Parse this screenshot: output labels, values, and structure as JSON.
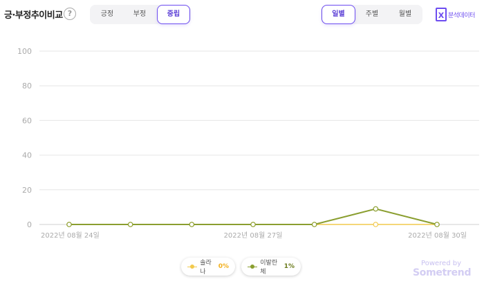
{
  "header": {
    "title": "긍·부정추이비교",
    "help_icon": "?",
    "sentiment_tabs": [
      {
        "label": "긍정",
        "active": false
      },
      {
        "label": "부정",
        "active": false
      },
      {
        "label": "중립",
        "active": true
      }
    ],
    "period_tabs": [
      {
        "label": "일별",
        "active": true
      },
      {
        "label": "주별",
        "active": false
      },
      {
        "label": "월별",
        "active": false
      }
    ],
    "analysis_button": {
      "label": "분석데이터",
      "icon": "excel-icon",
      "icon_glyph": "X"
    }
  },
  "chart_data": {
    "type": "line",
    "x": [
      "2022-08-24",
      "2022-08-25",
      "2022-08-26",
      "2022-08-27",
      "2022-08-28",
      "2022-08-29",
      "2022-08-30"
    ],
    "x_tick_labels": [
      "2022년 08월 24일",
      "",
      "",
      "2022년 08월 27일",
      "",
      "",
      "2022년 08월 30일"
    ],
    "ylim": [
      0,
      100
    ],
    "y_ticks": [
      0,
      20,
      40,
      60,
      80,
      100
    ],
    "grid": true,
    "legend_placement": "bottom",
    "series": [
      {
        "name": "솔라나",
        "values": [
          0,
          0,
          0,
          0,
          0,
          0,
          0
        ],
        "color": "#f2c94c",
        "legend_pct": "0%"
      },
      {
        "name": "이발란체",
        "values": [
          0,
          0,
          0,
          0,
          0,
          9,
          0
        ],
        "color": "#8a9e2f",
        "legend_pct": "1%"
      }
    ]
  },
  "footer": {
    "powered_by": "Powered by",
    "brand": "Sometrend"
  },
  "colors": {
    "accent": "#6c4cf0",
    "grid": "#e6e6e6",
    "axis_text": "#aaaaaa"
  }
}
